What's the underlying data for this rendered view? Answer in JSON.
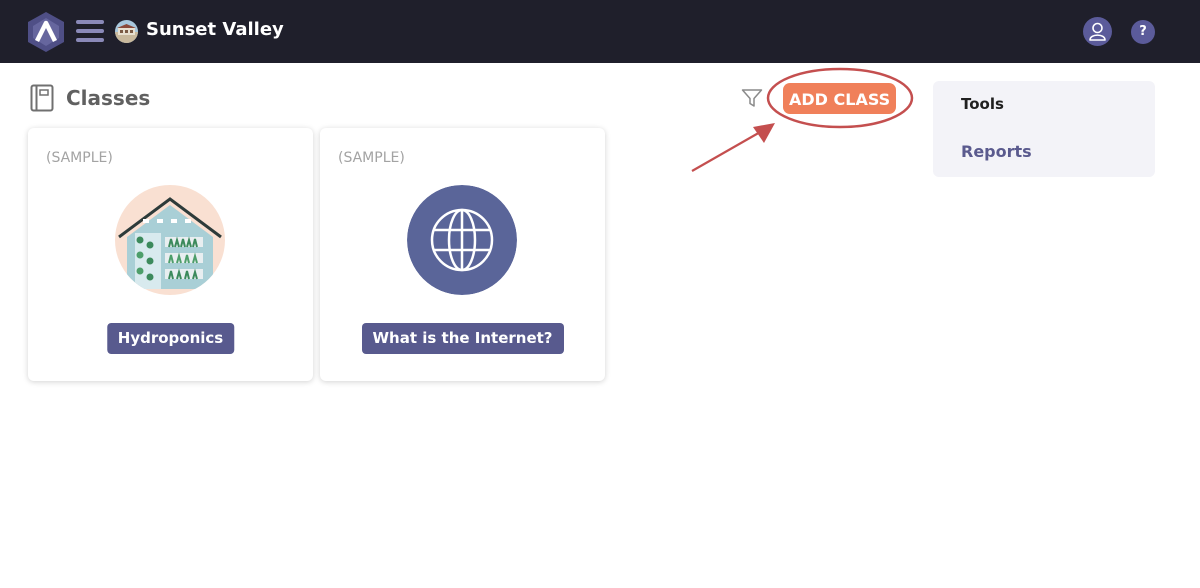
{
  "topbar": {
    "school_name": "Sunset Valley",
    "help_label": "?",
    "icons": {
      "logo": "app-logo-icon",
      "menu": "hamburger-menu-icon",
      "school": "school-avatar-icon",
      "account": "user-icon",
      "help": "help-icon"
    }
  },
  "header": {
    "title": "Classes",
    "add_class_label": "ADD CLASS",
    "icons": {
      "classes": "notebook-icon",
      "filter": "filter-icon"
    }
  },
  "classes": [
    {
      "sample_tag": "(SAMPLE)",
      "name": "Hydroponics",
      "image": "greenhouse-image"
    },
    {
      "sample_tag": "(SAMPLE)",
      "name": "What is the Internet?",
      "image": "globe-icon"
    }
  ],
  "sidebar": {
    "heading": "Tools",
    "links": [
      {
        "label": "Reports"
      }
    ]
  },
  "colors": {
    "topbar_bg": "#1f1f2b",
    "accent_orange": "#f0805a",
    "label_purple": "#585a8e",
    "annotation_red": "#c44f4f",
    "panel_bg": "#f3f3f8"
  }
}
